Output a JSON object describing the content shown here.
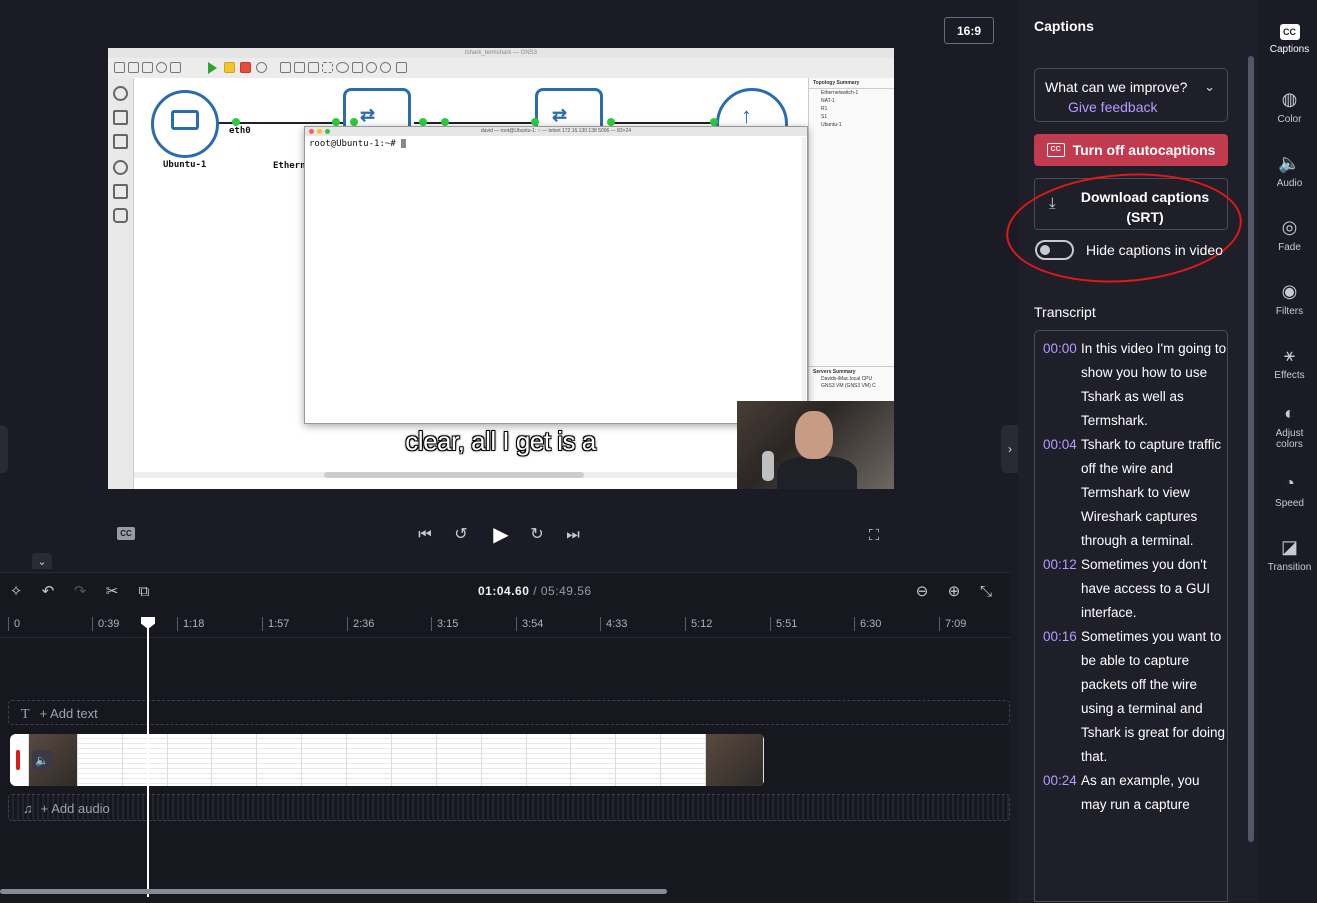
{
  "preview": {
    "aspect_ratio": "16:9",
    "caption_overlay": "clear, all I get is a",
    "gns3": {
      "window_title": "tshark_termshark — GNS3",
      "nodes": [
        "Ubuntu-1",
        "Etherne"
      ],
      "port_label": "eth0",
      "topology_summary_title": "Topology Summary",
      "topology_items": [
        "Ethernetswitch-1",
        "NAT-1",
        "R1",
        "S1",
        "Ubuntu-1"
      ],
      "servers_summary_title": "Servers Summary",
      "server_items": [
        "Davids-iMac.local CPU",
        "GNS3 VM (GNS3 VM) C"
      ],
      "terminal_title": "david — root@Ubuntu-1: ~ — telnet 172.16.130.138 5006 — 83×24",
      "terminal_prompt": "root@Ubuntu-1:~#"
    }
  },
  "playback": {
    "cc_label": "CC"
  },
  "timeline": {
    "current_time": "01:04.60",
    "total_time": "/ 05:49.56",
    "ruler_ticks": [
      "0",
      "0:39",
      "1:18",
      "1:57",
      "2:36",
      "3:15",
      "3:54",
      "4:33",
      "5:12",
      "5:51",
      "6:30",
      "7:09"
    ],
    "add_text_label": "+ Add text",
    "add_audio_label": "+ Add audio"
  },
  "captions_panel": {
    "title": "Captions",
    "feedback_question": "What can we improve?",
    "feedback_link": "Give feedback",
    "turn_off_label": "Turn off autocaptions",
    "download_label": "Download captions (SRT)",
    "hide_toggle_label": "Hide captions in video",
    "transcript_title": "Transcript",
    "transcript": [
      {
        "time": "00:00",
        "text": "In this video I'm going to show you how to use Tshark as well as Termshark."
      },
      {
        "time": "00:04",
        "text": "Tshark to capture traffic off the wire and Termshark to view Wireshark captures through a terminal."
      },
      {
        "time": "00:12",
        "text": "Sometimes you don't have access to a GUI interface."
      },
      {
        "time": "00:16",
        "text": "Sometimes you want to be able to capture packets off the wire using a terminal and Tshark is great for doing that."
      },
      {
        "time": "00:24",
        "text": "As an example, you may run a capture"
      }
    ]
  },
  "rail": [
    {
      "label": "Captions",
      "icon": "captions-icon"
    },
    {
      "label": "Color",
      "icon": "palette-icon"
    },
    {
      "label": "Audio",
      "icon": "speaker-icon"
    },
    {
      "label": "Fade",
      "icon": "fade-icon"
    },
    {
      "label": "Filters",
      "icon": "filters-icon"
    },
    {
      "label": "Effects",
      "icon": "magic-wand-icon"
    },
    {
      "label": "Adjust colors",
      "icon": "contrast-icon"
    },
    {
      "label": "Speed",
      "icon": "speedometer-icon"
    },
    {
      "label": "Transition",
      "icon": "transition-icon"
    }
  ],
  "colors": {
    "accent": "#b59bff",
    "danger": "#c23a4e",
    "annotation": "#e01818"
  }
}
